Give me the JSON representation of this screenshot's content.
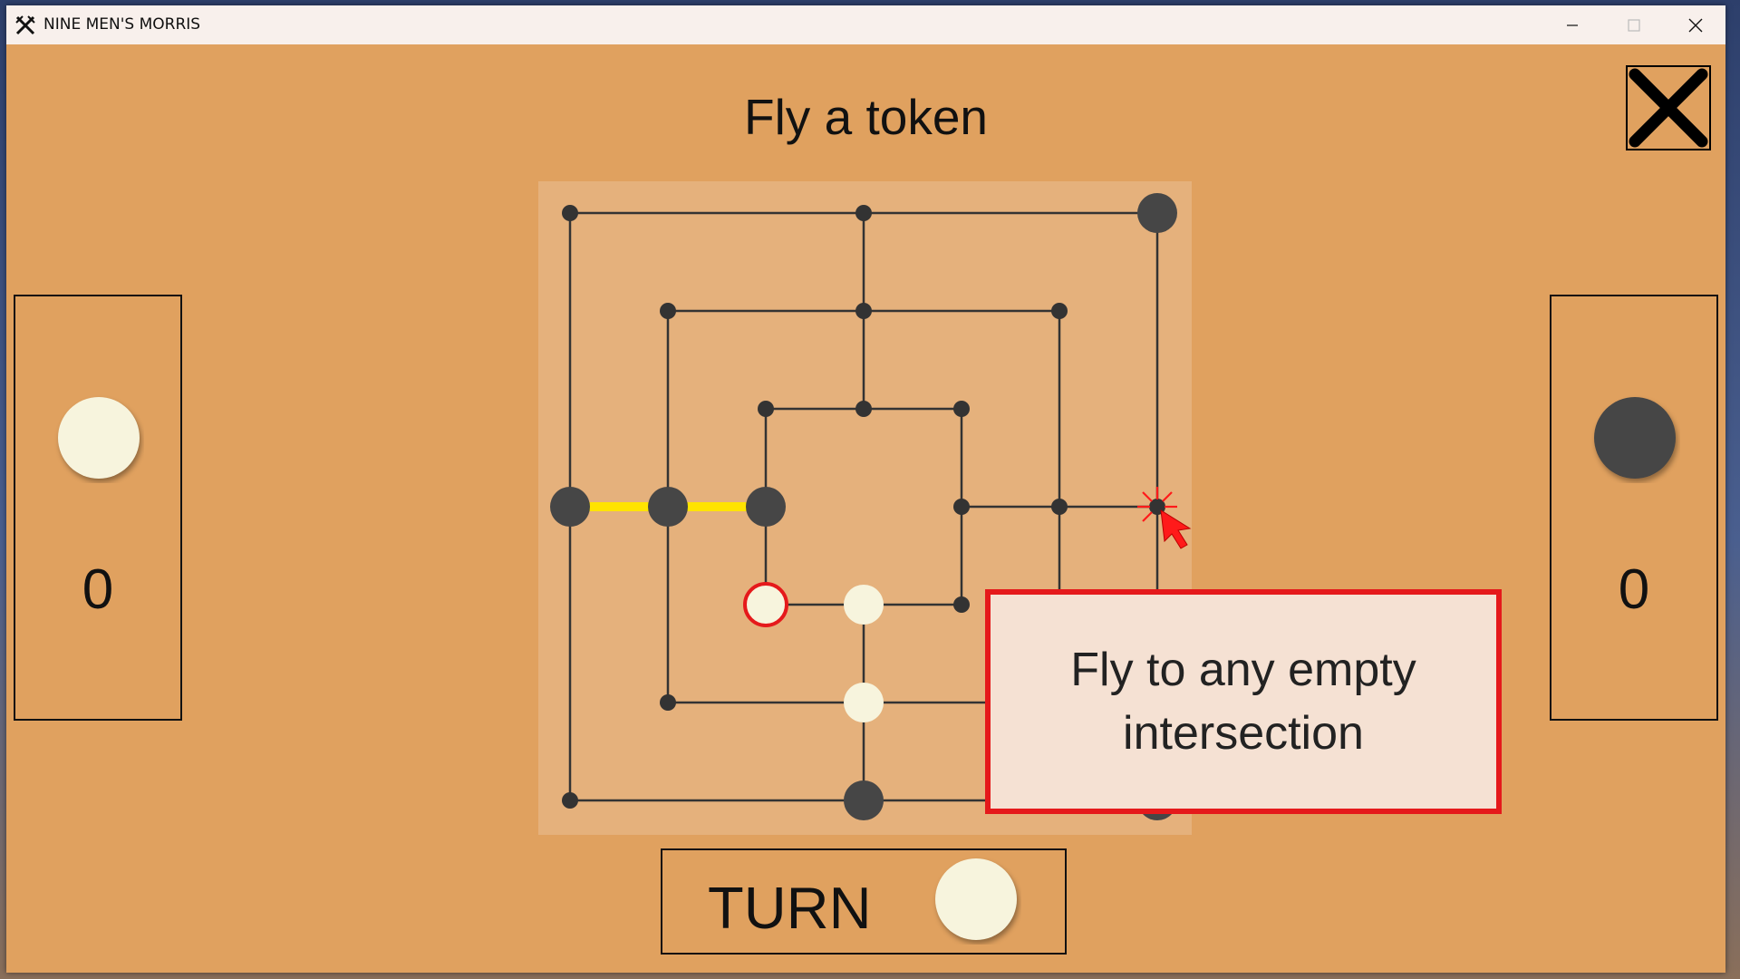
{
  "window": {
    "title": "NINE MEN'S MORRIS"
  },
  "game": {
    "instruction": "Fly a token",
    "left_score": "0",
    "right_score": "0",
    "turn_label": "TURN",
    "tooltip": "Fly to any empty intersection"
  },
  "colors": {
    "background": "#e0a15f",
    "board": "#e5b17c",
    "light_token": "#f7f4dd",
    "dark_token": "#464646",
    "mill_highlight": "#ffff00",
    "selected_outline": "#e5191b"
  },
  "icons": [
    "crossed-swords-icon",
    "minimize-icon",
    "maximize-icon",
    "close-icon",
    "exit-x-icon",
    "cursor-arrow-icon"
  ]
}
